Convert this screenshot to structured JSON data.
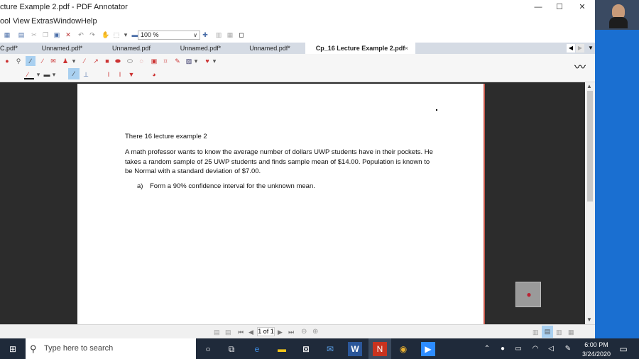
{
  "window": {
    "title": "cture Example 2.pdf - PDF Annotator",
    "minimize": "—",
    "maximize": "☐",
    "close": "✕"
  },
  "menu": [
    "ool",
    "View",
    "Extras",
    "Window",
    "Help"
  ],
  "toolbar": {
    "zoom_value": "100 %"
  },
  "tabs": [
    {
      "label": "C.pdf*",
      "active": false
    },
    {
      "label": "Unnamed.pdf*",
      "active": false
    },
    {
      "label": "Unnamed.pdf",
      "active": false
    },
    {
      "label": "Unnamed.pdf*",
      "active": false
    },
    {
      "label": "Unnamed.pdf*",
      "active": false
    },
    {
      "label": "Cp_16 Lecture Example 2.pdf",
      "active": true
    }
  ],
  "tab_close": "×",
  "document": {
    "heading": "There 16 lecture example 2",
    "para_line1": "A math professor wants to know the average number of dollars UWP students have in their pockets.  He",
    "para_line2": "takes a random sample of 25 UWP students and finds sample mean of $14.00.  Population is known to",
    "para_line3": "be Normal with a standard deviation of $7.00.",
    "item_a_label": "a)",
    "item_a_text": "Form a 90% confidence interval for the unknown mean."
  },
  "status": {
    "page_indicator": "1 of 1"
  },
  "taskbar": {
    "search_placeholder": "Type here to search",
    "time": "6:00 PM",
    "date": "3/24/2020"
  },
  "colors": {
    "accent": "#1a6fd1",
    "taskbar": "#1f2a3a",
    "page_border": "#c8584b"
  }
}
